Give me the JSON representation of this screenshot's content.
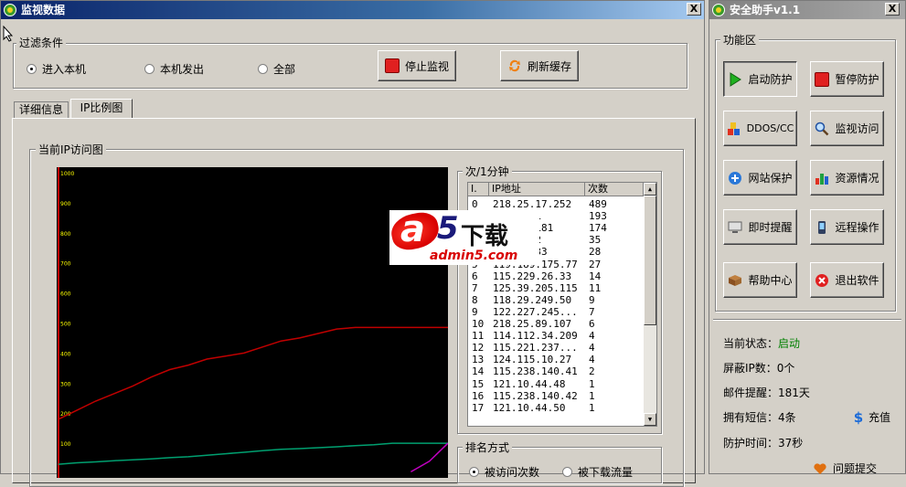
{
  "main_window": {
    "title": "监视数据",
    "close_glyph": "X",
    "filter": {
      "group_label": "过滤条件",
      "options": [
        {
          "label": "进入本机",
          "selected": true
        },
        {
          "label": "本机发出",
          "selected": false
        },
        {
          "label": "全部",
          "selected": false
        }
      ],
      "stop_button": "停止监视",
      "refresh_button": "刷新缓存"
    },
    "tabs": [
      {
        "label": "详细信息",
        "active": false
      },
      {
        "label": "IP比例图",
        "active": true
      }
    ],
    "chart_panel": {
      "group_label": "当前IP访问图"
    },
    "list_panel": {
      "group_label": "次/1分钟",
      "columns": [
        "I.",
        "IP地址",
        "次数"
      ],
      "rows": [
        [
          "0",
          "218.25.17.252",
          "489"
        ],
        [
          "1",
          "246.88.1",
          "193"
        ],
        [
          "2",
          "254.47.181",
          "174"
        ],
        [
          "3",
          "144.76.2",
          "35"
        ],
        [
          "4",
          "34.100.33",
          "28"
        ],
        [
          "5",
          "119.189.175.77",
          "27"
        ],
        [
          "6",
          "115.229.26.33",
          "14"
        ],
        [
          "7",
          "125.39.205.115",
          "11"
        ],
        [
          "8",
          "118.29.249.50",
          "9"
        ],
        [
          "9",
          "122.227.245...",
          "7"
        ],
        [
          "10",
          "218.25.89.107",
          "6"
        ],
        [
          "11",
          "114.112.34.209",
          "4"
        ],
        [
          "12",
          "115.221.237...",
          "4"
        ],
        [
          "13",
          "124.115.10.27",
          "4"
        ],
        [
          "14",
          "115.238.140.41",
          "2"
        ],
        [
          "15",
          "121.10.44.48",
          "1"
        ],
        [
          "16",
          "115.238.140.42",
          "1"
        ],
        [
          "17",
          "121.10.44.50",
          "1"
        ]
      ]
    },
    "sort_panel": {
      "group_label": "排名方式",
      "options": [
        {
          "label": "被访问次数",
          "selected": true
        },
        {
          "label": "被下载流量",
          "selected": false
        }
      ]
    }
  },
  "assistant_window": {
    "title": "安全助手v1.1",
    "close_glyph": "X",
    "group_label": "功能区",
    "buttons": [
      {
        "label": "启动防护",
        "icon": "play-icon"
      },
      {
        "label": "暂停防护",
        "icon": "stop-icon"
      },
      {
        "label": "DDOS/CC",
        "icon": "blocks-icon"
      },
      {
        "label": "监视访问",
        "icon": "magnifier-icon"
      },
      {
        "label": "网站保护",
        "icon": "plus-globe-icon"
      },
      {
        "label": "资源情况",
        "icon": "bar-chart-icon"
      },
      {
        "label": "即时提醒",
        "icon": "monitor-icon"
      },
      {
        "label": "远程操作",
        "icon": "phone-icon"
      },
      {
        "label": "帮助中心",
        "icon": "book-icon"
      },
      {
        "label": "退出软件",
        "icon": "exit-icon"
      }
    ],
    "status": {
      "current_state_label": "当前状态：",
      "current_state_value": "启动",
      "blocked_ip_label": "屏蔽IP数：",
      "blocked_ip_value": "0个",
      "mail_label": "邮件提醒：",
      "mail_value": "181天",
      "sms_label": "拥有短信：",
      "sms_value": "4条",
      "recharge_label": "充值",
      "protect_label": "防护时间：",
      "protect_value": "37秒",
      "feedback_label": "问题提交"
    }
  },
  "watermark": {
    "brand_a": "a",
    "brand_five": "5",
    "brand_text": "下载",
    "url": "admin5.com"
  },
  "colors": {
    "title_bar": "#0a246a",
    "status_ok": "#008000",
    "red_series": "#c00000",
    "green_series": "#00a070",
    "magenta_series": "#c000c0",
    "axis_labels": "#ffff00"
  },
  "chart_data": {
    "type": "line",
    "y_ticks": [
      "1000",
      "900",
      "800",
      "700",
      "600",
      "500",
      "400",
      "300",
      "200",
      "100"
    ],
    "ylim": [
      0,
      1000
    ],
    "grid": false,
    "series": [
      {
        "color": "#c00000",
        "values": [
          180,
          210,
          240,
          265,
          290,
          320,
          345,
          360,
          380,
          390,
          400,
          420,
          440,
          450,
          465,
          480,
          485,
          485,
          485,
          485,
          485,
          485
        ]
      },
      {
        "color": "#00a070",
        "values": [
          30,
          35,
          38,
          42,
          45,
          48,
          52,
          55,
          60,
          65,
          70,
          75,
          80,
          82,
          85,
          88,
          92,
          95,
          100,
          100,
          100,
          100
        ]
      },
      {
        "color": "#c000c0",
        "values": [
          null,
          null,
          null,
          null,
          null,
          null,
          null,
          null,
          null,
          null,
          null,
          null,
          null,
          null,
          null,
          null,
          null,
          null,
          null,
          5,
          40,
          100
        ]
      }
    ]
  }
}
